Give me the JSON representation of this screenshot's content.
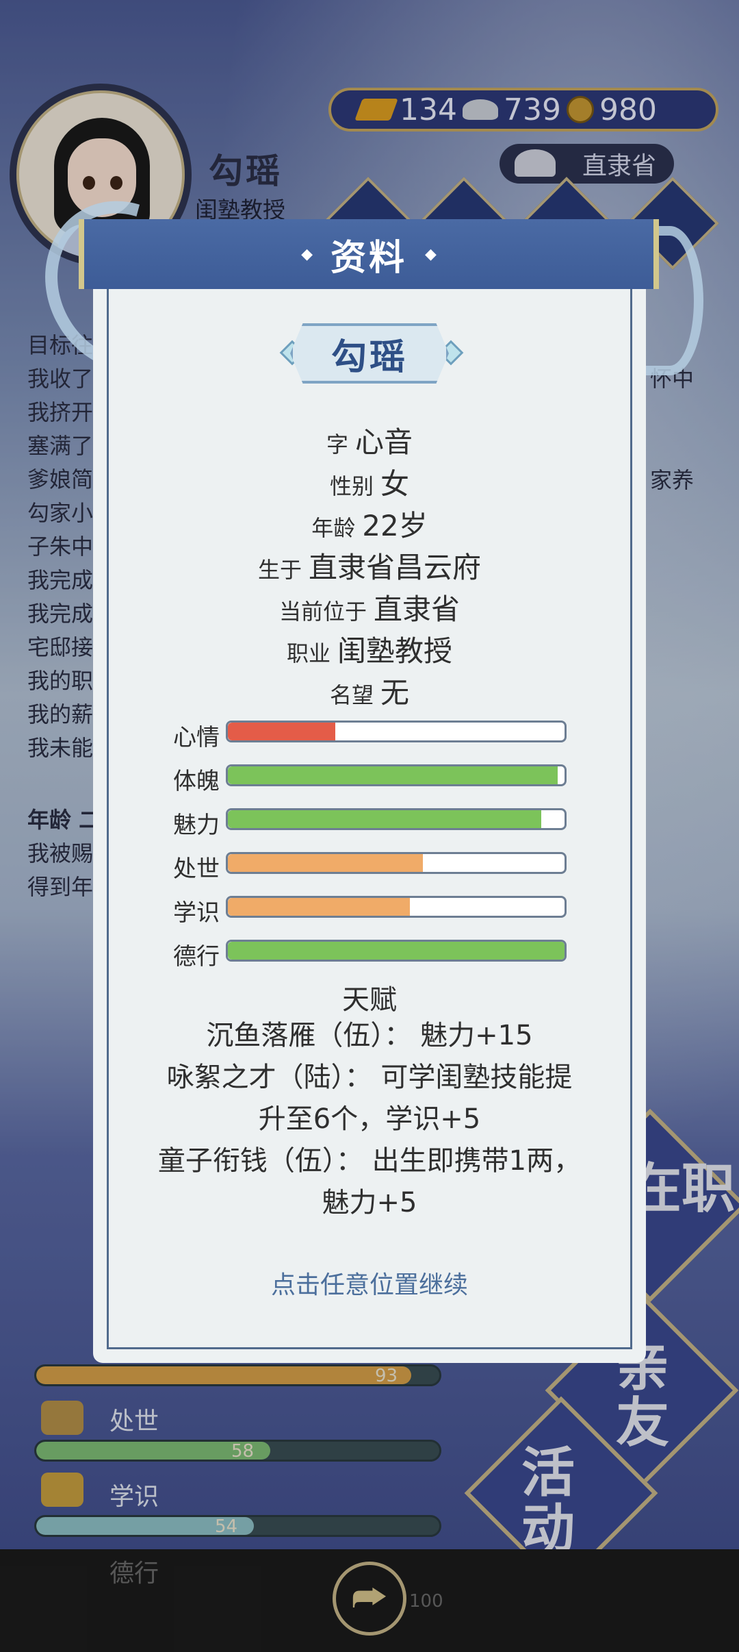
{
  "player": {
    "name": "勾瑶",
    "title": "闺塾教授"
  },
  "currency": {
    "gold": "134",
    "silver": "739",
    "coins": "980"
  },
  "location": "直隶省",
  "log": {
    "lines": [
      "目标往",
      "我收了",
      "我挤开",
      "塞满了",
      "爹娘简",
      "勾家小",
      "子朱中",
      "我完成",
      "我完成",
      "宅邸接",
      "我的职",
      "我的薪",
      "我未能"
    ],
    "right_fragments": [
      "怀中",
      "家养"
    ],
    "age_heading": "年龄 二",
    "age_lines": [
      "我被赐",
      "得到年"
    ]
  },
  "lower_stats": [
    {
      "label": "",
      "value": "93",
      "fill_pct": 93,
      "color": "#d8a24a"
    },
    {
      "label": "处世",
      "value": "58",
      "fill_pct": 58,
      "color": "#7fbf77"
    },
    {
      "label": "学识",
      "value": "54",
      "fill_pct": 54,
      "color": "#8fc3c8"
    },
    {
      "label": "德行",
      "value": "100",
      "fill_pct": 100,
      "color": "#b7a55a"
    }
  ],
  "side_buttons": {
    "job_partial": "在职",
    "friends": "亲友",
    "activity": "活动"
  },
  "modal": {
    "title": "资料",
    "name": "勾瑶",
    "fields": [
      {
        "key": "字",
        "value": "心音"
      },
      {
        "key": "性别",
        "value": "女"
      },
      {
        "key": "年龄",
        "value": "22岁"
      },
      {
        "key": "生于",
        "value": "直隶省昌云府"
      },
      {
        "key": "当前位于",
        "value": "直隶省"
      },
      {
        "key": "职业",
        "value": "闺塾教授"
      },
      {
        "key": "名望",
        "value": "无"
      }
    ],
    "stats": [
      {
        "label": "心情",
        "fill": 0.32,
        "color": "#e45c48"
      },
      {
        "label": "体魄",
        "fill": 0.98,
        "color": "#7cc35a"
      },
      {
        "label": "魅力",
        "fill": 0.93,
        "color": "#7cc35a"
      },
      {
        "label": "处世",
        "fill": 0.58,
        "color": "#f0ab68"
      },
      {
        "label": "学识",
        "fill": 0.54,
        "color": "#f0ab68"
      },
      {
        "label": "德行",
        "fill": 1.0,
        "color": "#7cc35a"
      }
    ],
    "talent_heading": "天赋",
    "talents": [
      [
        "沉鱼落雁（伍）：  魅力+15"
      ],
      [
        "咏絮之才（陆）：  可学闺塾技能提",
        "升至6个，学识+5"
      ],
      [
        "童子衔钱（伍）：  出生即携带1两，",
        "魅力+5"
      ]
    ],
    "continue_hint": "点击任意位置继续"
  }
}
